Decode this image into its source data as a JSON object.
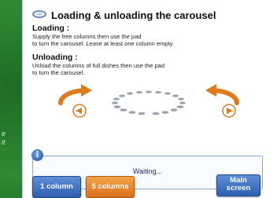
{
  "header": {
    "title": "Loading & unloading the carousel",
    "icon": "carousel-icon"
  },
  "loading": {
    "heading": "Loading :",
    "line1": "Supply the free columns then use the pad",
    "line2": "to turn the carousel. Leave at least one column empty."
  },
  "unloading": {
    "heading": "Unloading :",
    "line1": "Unload the columns of full dishes then use the pad",
    "line2": "to turn the carousel."
  },
  "status": {
    "text": "Waiting..."
  },
  "buttons": {
    "one_column": "1 column",
    "five_columns": "5 columns",
    "main_line1": "Main",
    "main_line2": "screen"
  },
  "side_text": {
    "a": "e",
    "b": "it"
  },
  "colors": {
    "blue": "#2d5eb0",
    "orange": "#d9701a",
    "bg_green": "#2d8a32"
  }
}
